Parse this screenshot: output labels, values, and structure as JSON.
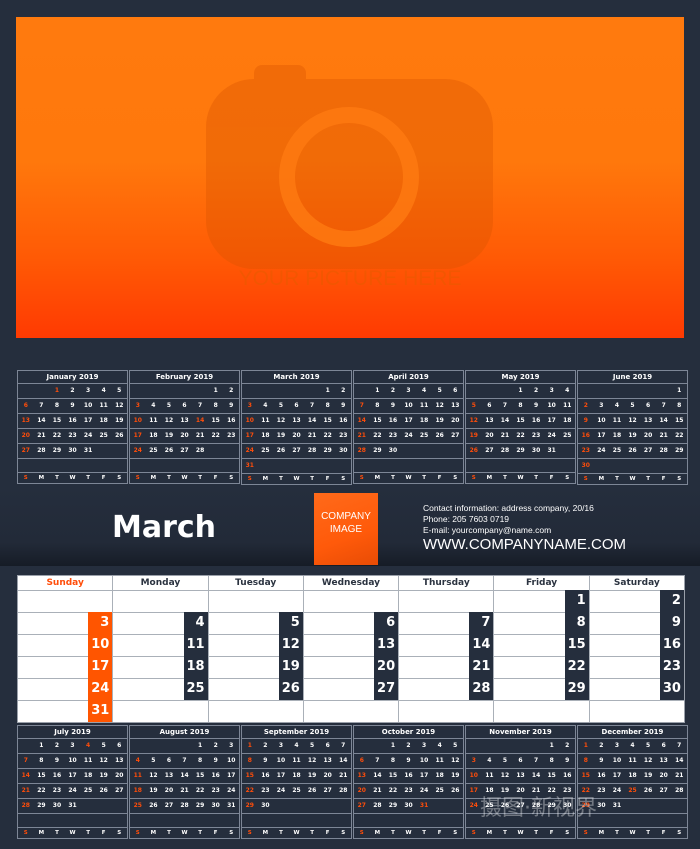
{
  "photo": {
    "placeholder_text": "YOUR PICTURE HERE",
    "icon": "camera-icon"
  },
  "colors": {
    "accent": "#ff5500",
    "background": "#252e3d",
    "cell_dark": "#252e3d"
  },
  "header": {
    "month_title": "March",
    "logo_line1": "COMPANY",
    "logo_line2": "IMAGE",
    "contact_info": "Contact information: address company, 20/16",
    "phone": "Phone: 205 7603 0719",
    "email": "E-mail: yourcompany@name.com",
    "website": "WWW.COMPANYNAME.COM"
  },
  "mini_weekdays": [
    "S",
    "M",
    "T",
    "W",
    "T",
    "F",
    "S"
  ],
  "mini_calendars_top": [
    {
      "title": "January 2019",
      "start": 2,
      "days": 31,
      "red": [
        1
      ]
    },
    {
      "title": "February 2019",
      "start": 5,
      "days": 28,
      "red": [
        14
      ]
    },
    {
      "title": "March 2019",
      "start": 5,
      "days": 31,
      "red": []
    },
    {
      "title": "April 2019",
      "start": 1,
      "days": 30,
      "red": []
    },
    {
      "title": "May 2019",
      "start": 3,
      "days": 31,
      "red": []
    },
    {
      "title": "June 2019",
      "start": 6,
      "days": 30,
      "red": []
    }
  ],
  "mini_calendars_bottom": [
    {
      "title": "July 2019",
      "start": 1,
      "days": 31,
      "red": [
        4
      ]
    },
    {
      "title": "August 2019",
      "start": 4,
      "days": 31,
      "red": []
    },
    {
      "title": "September 2019",
      "start": 0,
      "days": 30,
      "red": []
    },
    {
      "title": "October 2019",
      "start": 2,
      "days": 31,
      "red": [
        31
      ]
    },
    {
      "title": "November 2019",
      "start": 5,
      "days": 30,
      "red": []
    },
    {
      "title": "December 2019",
      "start": 0,
      "days": 31,
      "red": [
        25
      ]
    }
  ],
  "main_calendar": {
    "weekdays": [
      "Sunday",
      "Monday",
      "Tuesday",
      "Wednesday",
      "Thursday",
      "Friday",
      "Saturday"
    ],
    "start": 5,
    "days": 31
  },
  "watermark": "摄图·新视界"
}
